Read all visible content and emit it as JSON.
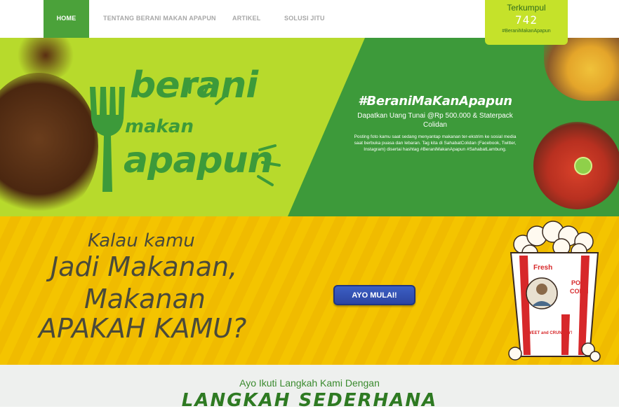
{
  "nav": {
    "home": "HOME",
    "tentang": "TENTANG BERANI MAKAN APAPUN",
    "artikel": "ARTIKEL",
    "solusi": "SOLUSI JITU"
  },
  "counter": {
    "title": "Terkumpul",
    "count": "742",
    "hashtag": "#BeraniMakanApapun"
  },
  "hero": {
    "logo": {
      "line1": "berani",
      "line2": "makan",
      "line3": "apapun"
    },
    "promo_heading": "#BeraniMaKanApapun",
    "promo_sub": "Dapatkan Uang Tunai @Rp 500.000 & Staterpack Colidan",
    "promo_desc": "Posting foto kamu saat sedang menyantap makanan ter-ekstrim ke sosial media saat berbuka puasa dan lebaran. Tag kita di SahabatColidan (Facebook, Twitter, Instagram) disertai hashtag #BeraniMakanApapun #SahabatLambung."
  },
  "quiz": {
    "line1": "Kalau kamu",
    "line2": "Jadi Makanan,",
    "line3": "Makanan",
    "line4": "APAKAH KAMU?",
    "button": "AYO MULAI!",
    "popcorn_fresh": "Fresh",
    "popcorn_pop": "POP",
    "popcorn_corn": "CORN",
    "popcorn_sweet": "SWEET and CRUNCHY!"
  },
  "steps": {
    "intro": "Ayo Ikuti Langkah Kami Dengan",
    "title": "LANGKAH SEDERHANA"
  },
  "colors": {
    "green": "#4ba23a",
    "lime": "#b7da2c",
    "yellow": "#f4c400",
    "button_blue": "#2d45a2"
  }
}
